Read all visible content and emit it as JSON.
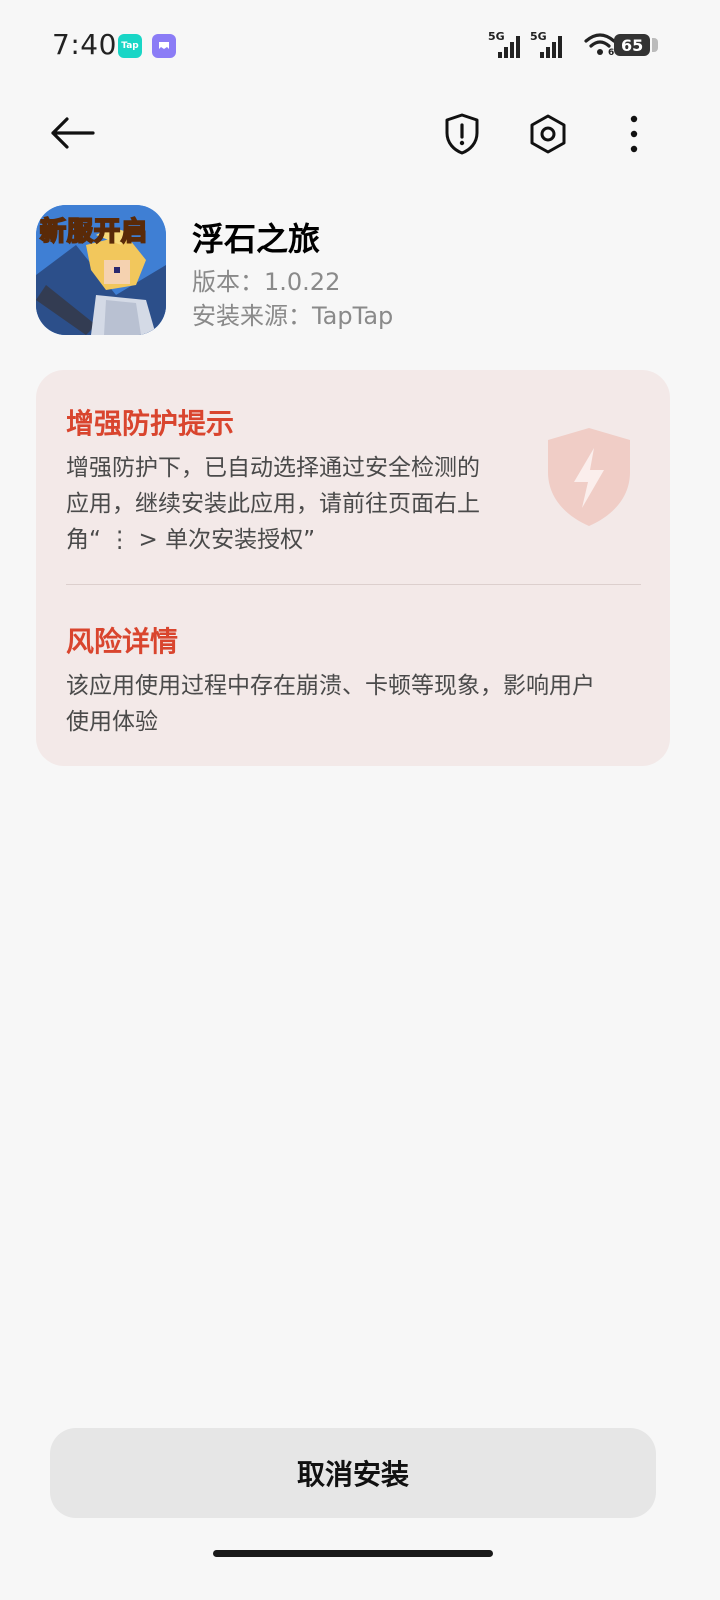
{
  "status_bar": {
    "time": "7:40",
    "tap_app_icon_text": "Tap",
    "signal_1": "5G",
    "signal_2": "5G",
    "wifi_sub": "6",
    "battery": "65"
  },
  "toolbar": {
    "back_icon": "arrow-left-icon",
    "shield_icon": "shield-exclamation-icon",
    "settings_icon": "settings-hexagon-icon",
    "more_icon": "more-vertical-icon"
  },
  "app": {
    "icon_badge": "新服开启",
    "name": "浮石之旅",
    "version": "版本：1.0.22",
    "source": "安装来源：TapTap"
  },
  "protection": {
    "title": "增强防护提示",
    "text_lines": [
      "增强防护下，已自动选择通过安全检测的",
      "应用，继续安装此应用，请前往页面右上",
      "角“ ⋮ > 单次安装授权”"
    ]
  },
  "risk": {
    "title": "风险详情",
    "text_lines": [
      "该应用使用过程中存在崩溃、卡顿等现象，影响用户",
      "使用体验"
    ]
  },
  "actions": {
    "cancel_install": "取消安装"
  },
  "colors": {
    "background": "#f7f7f7",
    "card_background": "#f3e9e8",
    "warning_red": "#d9452e",
    "button_background": "#e6e6e6"
  }
}
